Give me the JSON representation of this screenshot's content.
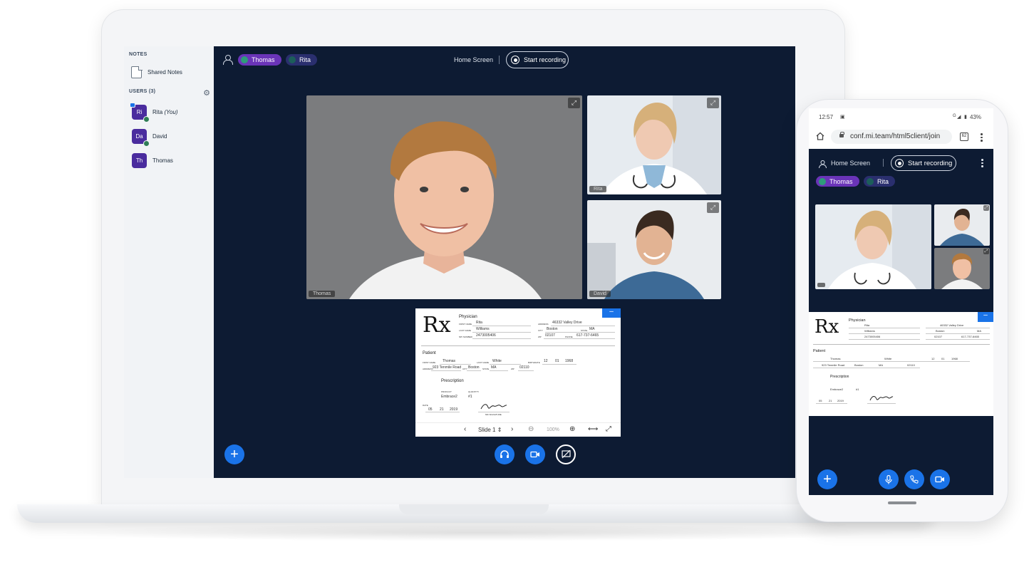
{
  "laptop": {
    "sidebar": {
      "notes_heading": "NOTES",
      "shared_notes_label": "Shared Notes",
      "users_heading": "USERS (3)",
      "users": [
        {
          "initials": "Ri",
          "name": "Rita",
          "suffix": "(You)"
        },
        {
          "initials": "Da",
          "name": "David",
          "suffix": ""
        },
        {
          "initials": "Th",
          "name": "Thomas",
          "suffix": ""
        }
      ]
    },
    "topbar": {
      "talking": [
        "Thomas",
        "Rita"
      ],
      "home_screen": "Home Screen",
      "record_label": "Start recording"
    },
    "videos": [
      {
        "label": "Thomas"
      },
      {
        "label": "Rita"
      },
      {
        "label": "David"
      }
    ],
    "presentation": {
      "rx": "Rx",
      "physician_heading": "Physician",
      "first_name_label": "FIRST NAME",
      "first_name": "Rita",
      "last_name_label": "LAST NAME",
      "last_name": "Williams",
      "npi_label": "NPI NUMBER",
      "npi": "2473005406",
      "address_label": "ADDRESS",
      "address": "46332 Valley Drive",
      "city_label": "CITY",
      "city": "Boston",
      "state_label": "STATE",
      "state": "MA",
      "zip_label": "ZIP",
      "zip": "02107",
      "phone_label": "PHONE",
      "phone": "617-737-6465",
      "patient_heading": "Patient",
      "patient_first": "Thomas",
      "patient_last": "White",
      "birthdate_label": "BIRTHDATE",
      "birth_mm": "12",
      "birth_dd": "01",
      "birth_yy": "1968",
      "patient_address": "923 Tenmile Road",
      "patient_city": "Boston",
      "patient_state": "MA",
      "patient_zip": "02110",
      "prescription_heading": "Prescription",
      "product_label": "PRODUCT",
      "product": "Embrace2",
      "quantity_label": "QUANTITY",
      "quantity": "#1",
      "date_label": "DATE",
      "date_mm": "05",
      "date_dd": "21",
      "date_yy": "2019",
      "signature_label": "MD SIGNATURE",
      "slide_label": "Slide 1",
      "zoom": "100%"
    }
  },
  "phone": {
    "time": "12:57",
    "battery": "43%",
    "network": "G",
    "url": "conf.mi.team/html5client/join",
    "tabs_count": "62",
    "home_screen": "Home Screen",
    "record_label": "Start recording",
    "talking": [
      "Thomas",
      "Rita"
    ]
  },
  "colors": {
    "app_background": "#0d1b33",
    "accent_blue": "#1a73e8",
    "avatar_purple": "#4a2c9e",
    "talking_pill_purple": "#6a34b8",
    "sidebar_background": "#f1f3f6"
  }
}
